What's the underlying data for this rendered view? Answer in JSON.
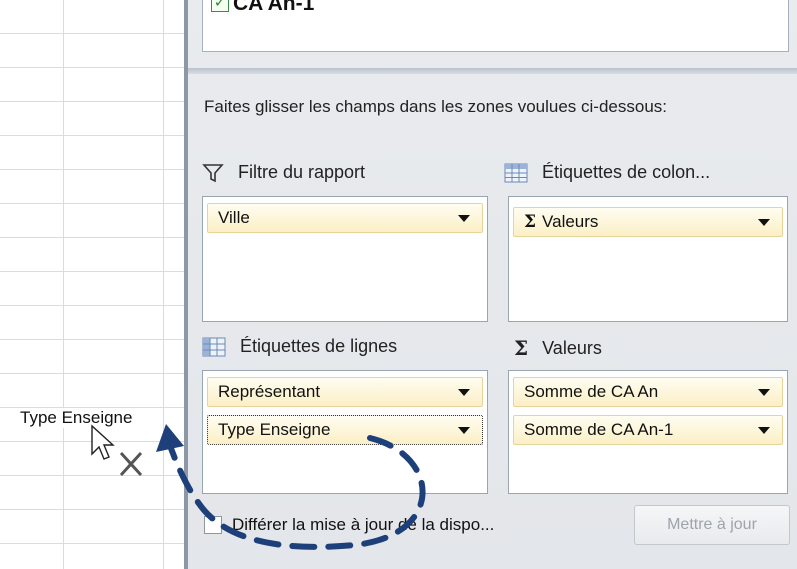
{
  "sheet": {
    "drag_label": "Type Enseigne"
  },
  "field_list": {
    "visible_field": "CA An-1",
    "checked": true
  },
  "panel": {
    "instructions": "Faites glisser les champs dans les zones voulues ci-dessous:",
    "zones": {
      "report_filter": {
        "title": "Filtre du rapport",
        "fields": [
          "Ville"
        ]
      },
      "column_labels": {
        "title": "Étiquettes de colon...",
        "fields": [
          "Valeurs"
        ]
      },
      "row_labels": {
        "title": "Étiquettes de lignes",
        "fields": [
          "Représentant",
          "Type Enseigne"
        ]
      },
      "values": {
        "title": "Valeurs",
        "fields": [
          "Somme de CA An",
          "Somme de CA An-1"
        ]
      }
    },
    "defer_label": "Différer la mise à jour de la dispo...",
    "update_button": "Mettre à jour"
  },
  "icons": {
    "filter": "filter-funnel-icon",
    "grid": "table-grid-icon",
    "sigma": "sigma-icon",
    "cursor": "arrow-cursor-icon",
    "remove": "remove-x-icon"
  },
  "colors": {
    "chip_bg": "#fbefc5",
    "annotation": "#1d3f7a",
    "panel_bg": "#e6e9ed"
  }
}
